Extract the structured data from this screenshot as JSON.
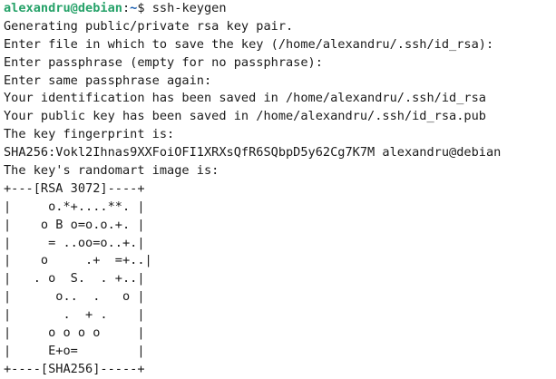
{
  "prompt": {
    "user_host": "alexandru@debian",
    "separator": ":",
    "path": "~",
    "symbol": "$ ",
    "command": "ssh-keygen"
  },
  "output": {
    "lines": [
      "Generating public/private rsa key pair.",
      "Enter file in which to save the key (/home/alexandru/.ssh/id_rsa):",
      "Enter passphrase (empty for no passphrase):",
      "Enter same passphrase again:",
      "Your identification has been saved in /home/alexandru/.ssh/id_rsa",
      "Your public key has been saved in /home/alexandru/.ssh/id_rsa.pub",
      "The key fingerprint is:",
      "SHA256:Vokl2Ihnas9XXFoiOFI1XRXsQfR6SQbpD5y62Cg7K7M alexandru@debian",
      "The key's randomart image is:",
      "+---[RSA 3072]----+",
      "|     o.*+....**. |",
      "|    o B o=o.o.+. |",
      "|     = ..oo=o..+.|",
      "|    o     .+  =+..|",
      "|   . o  S.  . +..|",
      "|      o..  .   o |",
      "|       .  + .    |",
      "|     o o o o     |",
      "|     E+o=        |",
      "+----[SHA256]-----+"
    ]
  }
}
